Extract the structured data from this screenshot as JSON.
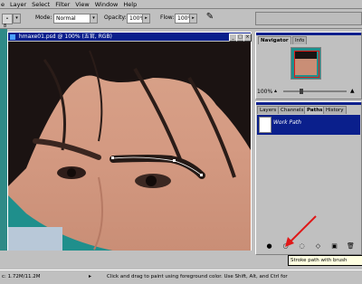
{
  "menu": [
    "e",
    "Layer",
    "Select",
    "Filter",
    "View",
    "Window",
    "Help"
  ],
  "options": {
    "mode_label": "Mode:",
    "mode_value": "Normal",
    "opacity_label": "Opacity:",
    "opacity_value": "100%",
    "flow_label": "Flow:",
    "flow_value": "100%"
  },
  "document": {
    "title": "hmaxe01.psd @ 100% (五官, RGB)"
  },
  "navigator": {
    "tabs": [
      "Navigator",
      "Info"
    ],
    "zoom": "100%"
  },
  "paths_panel": {
    "tabs": [
      "Layers",
      "Channels",
      "Paths",
      "History"
    ],
    "work_path": "Work Path"
  },
  "tooltip": "Stroke path with brush",
  "status": {
    "doc_size": "c: 1.72M/11.2M",
    "hint": "Click and drag to paint using foreground color.  Use Shift, Alt, and Ctrl for additio"
  },
  "colors": {
    "title_bar": "#0a1f8c",
    "background": "#2f8a87",
    "arrow": "#e01818",
    "tooltip_bg": "#ffffe1"
  }
}
